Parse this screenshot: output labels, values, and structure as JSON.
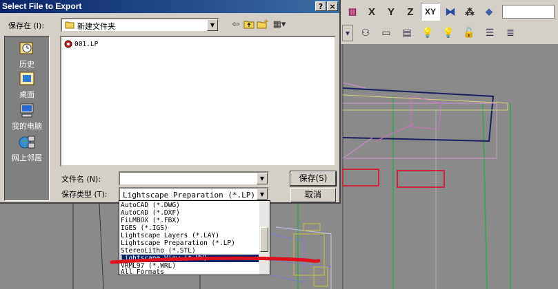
{
  "dialog": {
    "title": "Select File to Export",
    "caption_buttons": {
      "help": "?",
      "close": "×"
    },
    "save_in_label": "保存在 (I):",
    "save_in_value": "新建文件夹",
    "file_list": [
      {
        "name": "001.LP"
      }
    ],
    "places": [
      {
        "label": "历史",
        "icon": "history-icon"
      },
      {
        "label": "桌面",
        "icon": "desktop-icon"
      },
      {
        "label": "我的电脑",
        "icon": "my-computer-icon"
      },
      {
        "label": "网上邻居",
        "icon": "network-icon"
      }
    ],
    "filename_label": "文件名 (N):",
    "filename_value": "",
    "filetype_label": "保存类型 (T):",
    "filetype_value": "Lightscape Preparation (*.LP)",
    "save_button": "保存(S)",
    "cancel_button": "取消",
    "tool_icons": [
      "back-arrow-icon",
      "up-folder-icon",
      "new-folder-icon",
      "view-menu-icon"
    ]
  },
  "dropdown": {
    "options": [
      "AutoCAD (*.DWG)",
      "AutoCAD (*.DXF)",
      "FiLMBOX (*.FBX)",
      "IGES (*.IGS)",
      "Lightscape Layers (*.LAY)",
      "Lightscape Preparation (*.LP)",
      "StereoLitho (*.STL)",
      "Lightscape View (*.VW)",
      "VRML97 (*.WRL)",
      "All Formats"
    ],
    "selected_index": 7
  },
  "toolbar": {
    "axis_buttons": [
      "X",
      "Y",
      "Z",
      "XY"
    ],
    "pressed": "XY"
  },
  "colors": {
    "title_gradient_start": "#0a246a",
    "title_gradient_end": "#3a6ea5",
    "selection": "#0a246a",
    "annotation_red": "#e0101e"
  }
}
